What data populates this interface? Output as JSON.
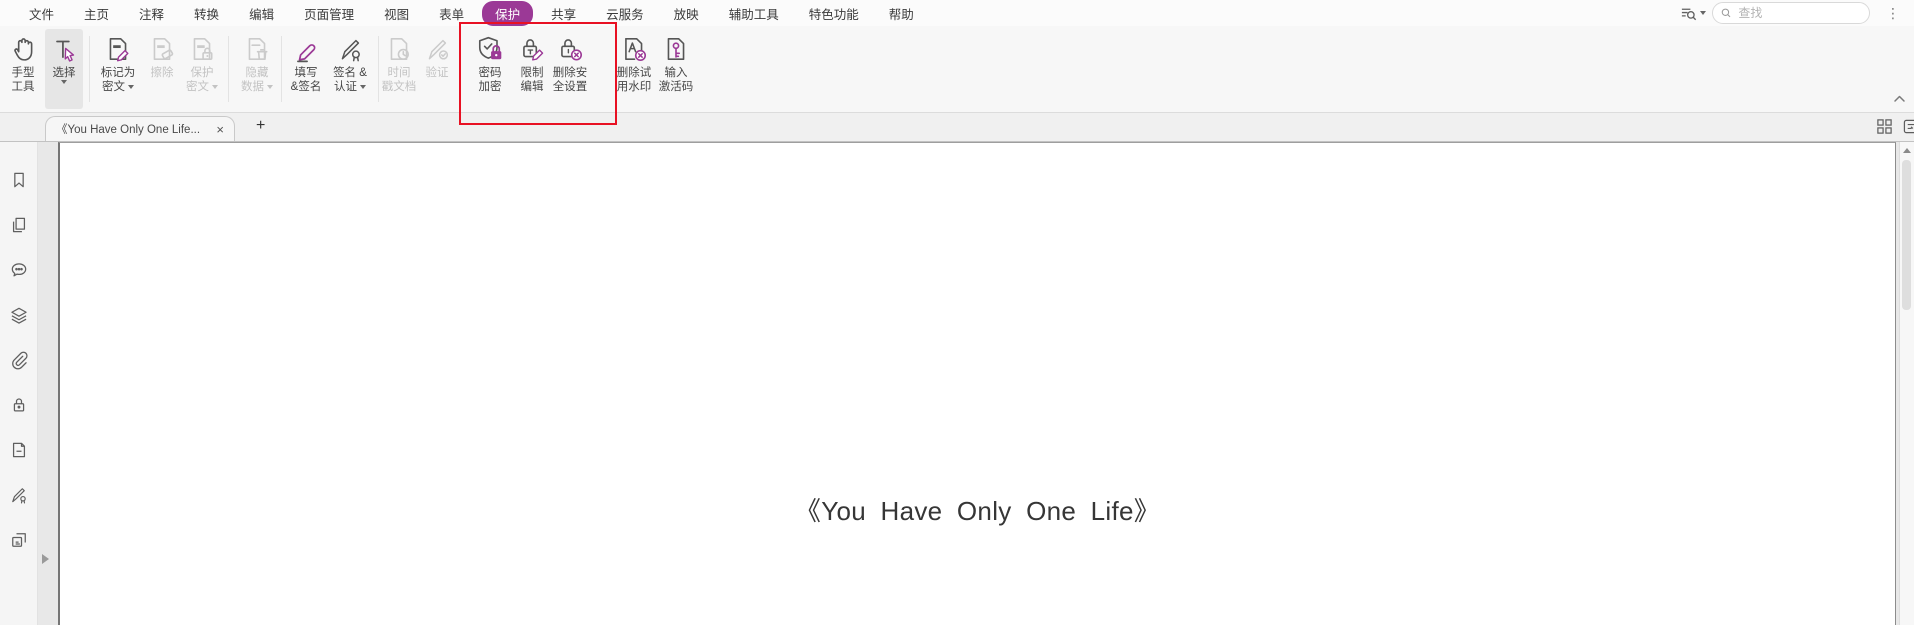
{
  "menu": {
    "items": [
      "文件",
      "主页",
      "注释",
      "转换",
      "编辑",
      "页面管理",
      "视图",
      "表单",
      "保护",
      "共享",
      "云服务",
      "放映",
      "辅助工具",
      "特色功能",
      "帮助"
    ],
    "active": "保护"
  },
  "topbar": {
    "search_placeholder": "查找",
    "kebab_glyph": "⋮"
  },
  "toolbar": {
    "buttons": [
      {
        "name": "hand-tool",
        "line1": "手型",
        "line2": "工具",
        "enabled": true
      },
      {
        "name": "select",
        "line1": "选择",
        "line2": "",
        "enabled": true
      },
      {
        "name": "mark-for-redaction",
        "line1": "标记为",
        "line2": "密文",
        "enabled": true
      },
      {
        "name": "erase",
        "line1": "擦除",
        "line2": "",
        "enabled": false
      },
      {
        "name": "protect-redaction",
        "line1": "保护",
        "line2": "密文",
        "enabled": false
      },
      {
        "name": "hide-data",
        "line1": "隐藏",
        "line2": "数据",
        "enabled": false
      },
      {
        "name": "fill-and-sign",
        "line1": "填写",
        "line2": "&签名",
        "enabled": true
      },
      {
        "name": "sign-and-certify",
        "line1": "签名 &",
        "line2": "认证",
        "enabled": true
      },
      {
        "name": "timestamp-document",
        "line1": "时间",
        "line2": "戳文档",
        "enabled": false
      },
      {
        "name": "verify",
        "line1": "验证",
        "line2": "",
        "enabled": false
      },
      {
        "name": "password-encrypt",
        "line1": "密码",
        "line2": "加密",
        "enabled": true
      },
      {
        "name": "restrict-editing",
        "line1": "限制",
        "line2": "编辑",
        "enabled": true
      },
      {
        "name": "remove-security-settings",
        "line1": "删除安",
        "line2": "全设置",
        "enabled": true
      },
      {
        "name": "remove-trial-watermark",
        "line1": "删除试",
        "line2": "用水印",
        "enabled": true
      },
      {
        "name": "enter-activation-code",
        "line1": "输入",
        "line2": "激活码",
        "enabled": true
      }
    ]
  },
  "tabbar": {
    "document_tab": "《You Have Only One Life...",
    "close_glyph": "×",
    "new_tab_glyph": "+"
  },
  "sidebar": {
    "icons": [
      "bookmark-icon",
      "page-thumbnails-icon",
      "comments-icon",
      "layers-icon",
      "attachments-icon",
      "security-icon",
      "field-icon",
      "digital-signature-icon",
      "destinations-icon"
    ]
  },
  "page": {
    "title": "《You Have Only One Life》"
  },
  "colors": {
    "accent": "#9b3996",
    "annotation_red": "#e81123"
  }
}
